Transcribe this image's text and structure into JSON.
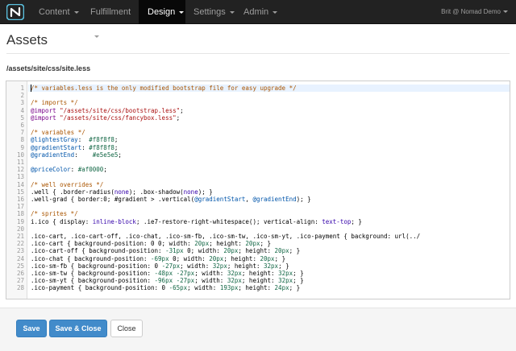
{
  "navbar": {
    "items": [
      {
        "label": "Content",
        "active": false
      },
      {
        "label": "Fulfillment",
        "active": false
      },
      {
        "label": "Design",
        "active": true
      },
      {
        "label": "Settings",
        "active": false
      },
      {
        "label": "Admin",
        "active": false
      }
    ],
    "user": "Brit @ Nomad Demo"
  },
  "page": {
    "title": "Assets",
    "file_path": "/assets/site/css/site.less"
  },
  "editor": {
    "line_numbers": [
      "1",
      "2",
      "3",
      "4",
      "5",
      "6",
      "7",
      "8",
      "9",
      "10",
      "11",
      "12",
      "13",
      "14",
      "15",
      "16",
      "17",
      "18",
      "19",
      "20",
      "21",
      "22",
      "23",
      "24",
      "25",
      "26",
      "27",
      "28"
    ],
    "lines": [
      "/* variables.less is the only modified bootstrap file for easy upgrade */",
      "",
      "/* imports */",
      "@import \"/assets/site/css/bootstrap.less\";",
      "@import \"/assets/site/css/fancybox.less\";",
      "",
      "/* variables */",
      "@lightestGray:  #f8f8f8;",
      "@gradientStart: #f8f8f8;",
      "@gradientEnd:    #e5e5e5;",
      "",
      "@priceColor: #af0000;",
      "",
      "/* well overrides */",
      ".well { .border-radius(none); .box-shadow(none); }",
      ".well-grad { border:0; #gradient > .vertical(@gradientStart, @gradientEnd); }",
      "",
      "/* sprites */",
      "i.ico { display: inline-block; .ie7-restore-right-whitespace(); vertical-align: text-top; }",
      "",
      ".ico-cart, .ico-cart-off, .ico-chat, .ico-sm-fb, .ico-sm-tw, .ico-sm-yt, .ico-payment { background: url(../",
      ".ico-cart { background-position: 0 0; width: 20px; height: 20px; }",
      ".ico-cart-off { background-position: -31px 0; width: 20px; height: 20px; }",
      ".ico-chat { background-position: -69px 0; width: 20px; height: 20px; }",
      ".ico-sm-fb { background-position: 0 -27px; width: 32px; height: 32px; }",
      ".ico-sm-tw { background-position: -48px -27px; width: 32px; height: 32px; }",
      ".ico-sm-yt { background-position: -96px -27px; width: 32px; height: 32px; }",
      ".ico-payment { background-position: 0 -65px; width: 193px; height: 24px; }"
    ]
  },
  "buttons": {
    "save": "Save",
    "save_close": "Save & Close",
    "close": "Close"
  },
  "colors": {
    "navbar_bg": "#222222",
    "primary": "#428bca",
    "footer_bg": "#f5f5f5"
  }
}
